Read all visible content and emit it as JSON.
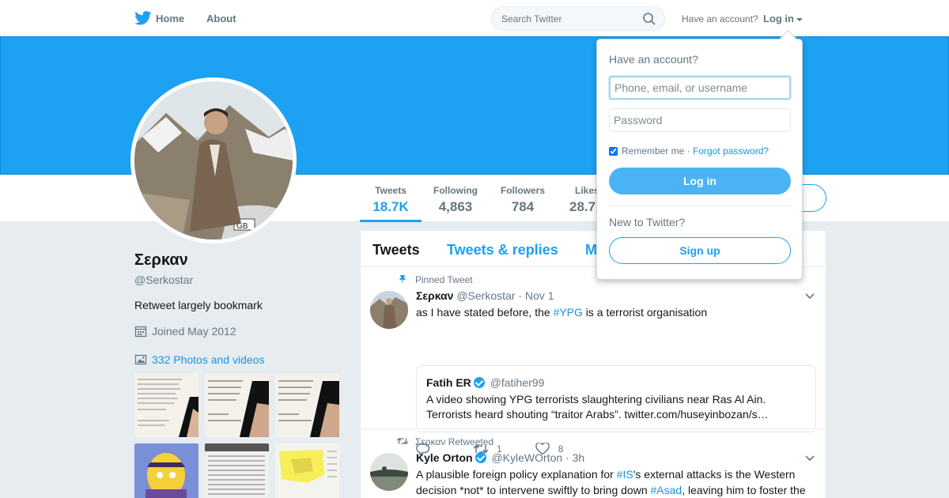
{
  "topbar": {
    "home_label": "Home",
    "about_label": "About",
    "search_placeholder": "Search Twitter",
    "have_account": "Have an account?",
    "login_label": "Log in"
  },
  "profile": {
    "name": "Σερκαν",
    "handle": "@Serkostar",
    "bio": "Retweet largely bookmark",
    "joined": "Joined May 2012",
    "photos_label": "332 Photos and videos"
  },
  "stats": [
    {
      "label": "Tweets",
      "value": "18.7K"
    },
    {
      "label": "Following",
      "value": "4,863"
    },
    {
      "label": "Followers",
      "value": "784"
    },
    {
      "label": "Likes",
      "value": "28.7"
    }
  ],
  "timeline": {
    "tabs": [
      "Tweets",
      "Tweets & replies",
      "M"
    ],
    "tweets": [
      {
        "context": "Pinned Tweet",
        "name": "Σερκαν",
        "handle": "@Serkostar",
        "time": "· Nov 1",
        "text_before": "as I have stated before, the ",
        "hashtag": "#YPG",
        "text_after": " is a terrorist organisation",
        "quote": {
          "name": "Fatih ER",
          "handle": "@fatiher99",
          "text": "A video showing YPG terrorists slaughtering civilians near Ras Al Ain. Terrorists heard shouting “traitor Arabs”. twitter.com/huseyinbozan/s…"
        },
        "retweets": "1",
        "likes": "8"
      },
      {
        "context": "Σερκαν Retweeted",
        "name": "Kyle Orton",
        "handle": "@KyleWOrton",
        "time": "· 3h",
        "text_p1": "A plausible foreign policy explanation for ",
        "hashtag1": "#IS",
        "text_p2": "'s external attacks is the Western decision *not* to intervene swiftly to bring down ",
        "hashtag2": "#Asad",
        "text_p3": ", leaving him to foster the"
      }
    ]
  },
  "login_dropdown": {
    "title": "Have an account?",
    "username_placeholder": "Phone, email, or username",
    "password_placeholder": "Password",
    "remember_label": "Remember me",
    "separator": " · ",
    "forgot_label": "Forgot password?",
    "login_button": "Log in",
    "new_label": "New to Twitter?",
    "signup_button": "Sign up"
  },
  "colors": {
    "brand": "#1da1f2",
    "link": "#1b95e0"
  }
}
